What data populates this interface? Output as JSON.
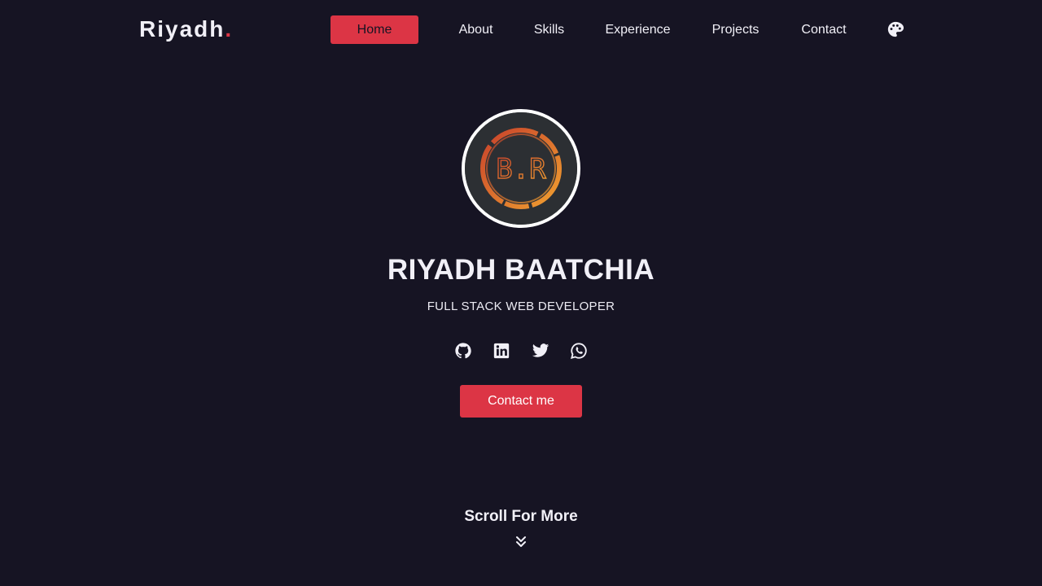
{
  "brand": {
    "name": "Riyadh",
    "dot": ".",
    "accent_color": "#dc3545"
  },
  "nav": {
    "items": [
      {
        "label": "Home",
        "active": true
      },
      {
        "label": "About",
        "active": false
      },
      {
        "label": "Skills",
        "active": false
      },
      {
        "label": "Experience",
        "active": false
      },
      {
        "label": "Projects",
        "active": false
      },
      {
        "label": "Contact",
        "active": false
      }
    ],
    "theme_icon": "palette-icon"
  },
  "hero": {
    "avatar_initials": "B.R",
    "name": "RIYADH BAATCHIA",
    "role": "FULL STACK WEB DEVELOPER",
    "socials": [
      {
        "icon": "github-icon"
      },
      {
        "icon": "linkedin-icon"
      },
      {
        "icon": "twitter-icon"
      },
      {
        "icon": "whatsapp-icon"
      }
    ],
    "cta_label": "Contact me"
  },
  "scroll": {
    "label": "Scroll For More",
    "icon": "double-chevron-down-icon"
  },
  "colors": {
    "background": "#161423",
    "text": "#f1f0f7",
    "accent": "#dc3545"
  }
}
